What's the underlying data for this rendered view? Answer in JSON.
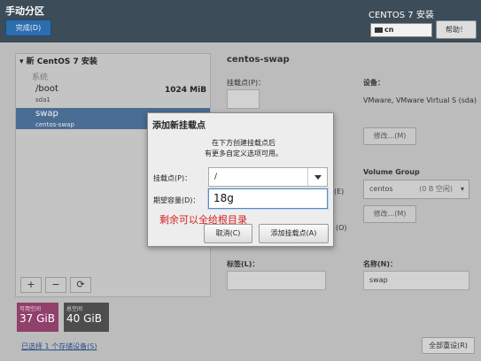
{
  "header": {
    "title": "手动分区",
    "done_button": "完成(D)",
    "install_title": "CENTOS 7 安装",
    "keyboard_layout": "cn",
    "help_button": "帮助！"
  },
  "left_panel": {
    "tree_header": "新 CentOS 7 安装",
    "group_label": "系统",
    "items": [
      {
        "name": "/boot",
        "device": "sda1",
        "size": "1024 MiB",
        "selected": false
      },
      {
        "name": "swap",
        "device": "centos-swap",
        "selected": true
      }
    ],
    "toolbar": {
      "add": "+",
      "remove": "−",
      "refresh": "⟳"
    },
    "free_space": {
      "label": "可用空间",
      "value": "37 GiB"
    },
    "total_space": {
      "label": "总空间",
      "value": "40 GiB"
    },
    "selected_devices_link": "已选择 1 个存储设备(S)",
    "reset_all_button": "全部重设(R)"
  },
  "right_panel": {
    "title": "centos-swap",
    "mount_point_label": "挂载点(P)：",
    "desired_capacity_partial": "(E)",
    "raid_partial": "(O)",
    "device_label": "设备：",
    "device_value": "VMware, VMware Virtual S (sda)",
    "modify_button": "修改...(M)",
    "volume_group_label": "Volume Group",
    "volume_group_value": "centos",
    "volume_group_free": "(0 B 空闲)",
    "modify_vg_button": "修改...(M)",
    "tag_label": "标签(L)：",
    "name_label": "名称(N)：",
    "name_value": "swap"
  },
  "dialog": {
    "title": "添加新挂载点",
    "description": "在下方创建挂载点后\n有更多自定义选项可用。",
    "mount_point_label": "挂载点(P)：",
    "mount_point_value": "/",
    "capacity_label": "期望容量(D)：",
    "capacity_value": "18g",
    "cancel_button": "取消(C)",
    "add_button": "添加挂载点(A)"
  },
  "annotation": "剩余可以全给根目录",
  "colors": {
    "header_bg": "#3c4c58",
    "done_button": "#2c6dad",
    "selected_row": "#4a6d93",
    "free_space": "#90406a",
    "total_space": "#4d4d4d",
    "annotation": "#d62020"
  }
}
